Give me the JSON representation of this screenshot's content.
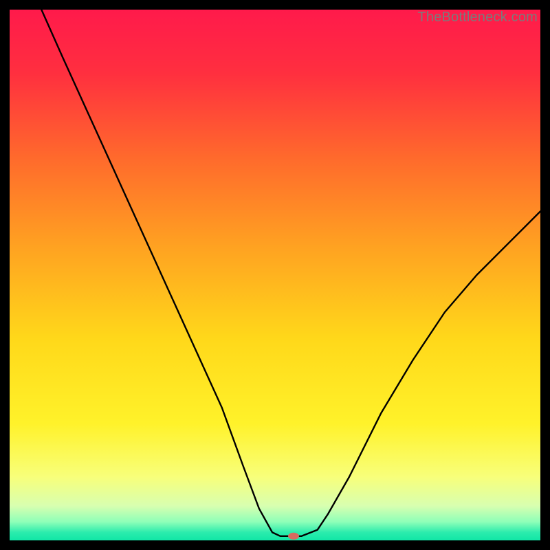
{
  "watermark": "TheBottleneck.com",
  "chart_data": {
    "type": "line",
    "title": "",
    "xlabel": "",
    "ylabel": "",
    "xlim": [
      0,
      100
    ],
    "ylim": [
      0,
      100
    ],
    "grid": false,
    "background_gradient": {
      "stops": [
        {
          "offset": 0.0,
          "color": "#ff1a4b"
        },
        {
          "offset": 0.12,
          "color": "#ff2f3f"
        },
        {
          "offset": 0.28,
          "color": "#ff6a2c"
        },
        {
          "offset": 0.45,
          "color": "#ffa321"
        },
        {
          "offset": 0.62,
          "color": "#ffd81a"
        },
        {
          "offset": 0.78,
          "color": "#fff22a"
        },
        {
          "offset": 0.88,
          "color": "#f8ff7a"
        },
        {
          "offset": 0.935,
          "color": "#d8ffb0"
        },
        {
          "offset": 0.965,
          "color": "#8effb8"
        },
        {
          "offset": 0.985,
          "color": "#2becad"
        },
        {
          "offset": 1.0,
          "color": "#11e6a6"
        }
      ]
    },
    "series": [
      {
        "name": "bottleneck-curve",
        "stroke": "#000000",
        "stroke_width": 2.4,
        "x": [
          6,
          10,
          15,
          20,
          25,
          30,
          35,
          40,
          44,
          47,
          49.5,
          51,
          55,
          58,
          60,
          64,
          70,
          76,
          82,
          88,
          94,
          100
        ],
        "y": [
          100,
          91,
          80,
          69,
          58,
          47,
          36,
          25,
          14,
          6,
          1.5,
          0.8,
          0.8,
          2,
          5,
          12,
          24,
          34,
          43,
          50,
          56,
          62
        ]
      }
    ],
    "marker": {
      "name": "optimal-point",
      "x": 53.5,
      "y": 0.8,
      "rx": 8,
      "ry": 5,
      "fill": "#d86a5f"
    }
  }
}
